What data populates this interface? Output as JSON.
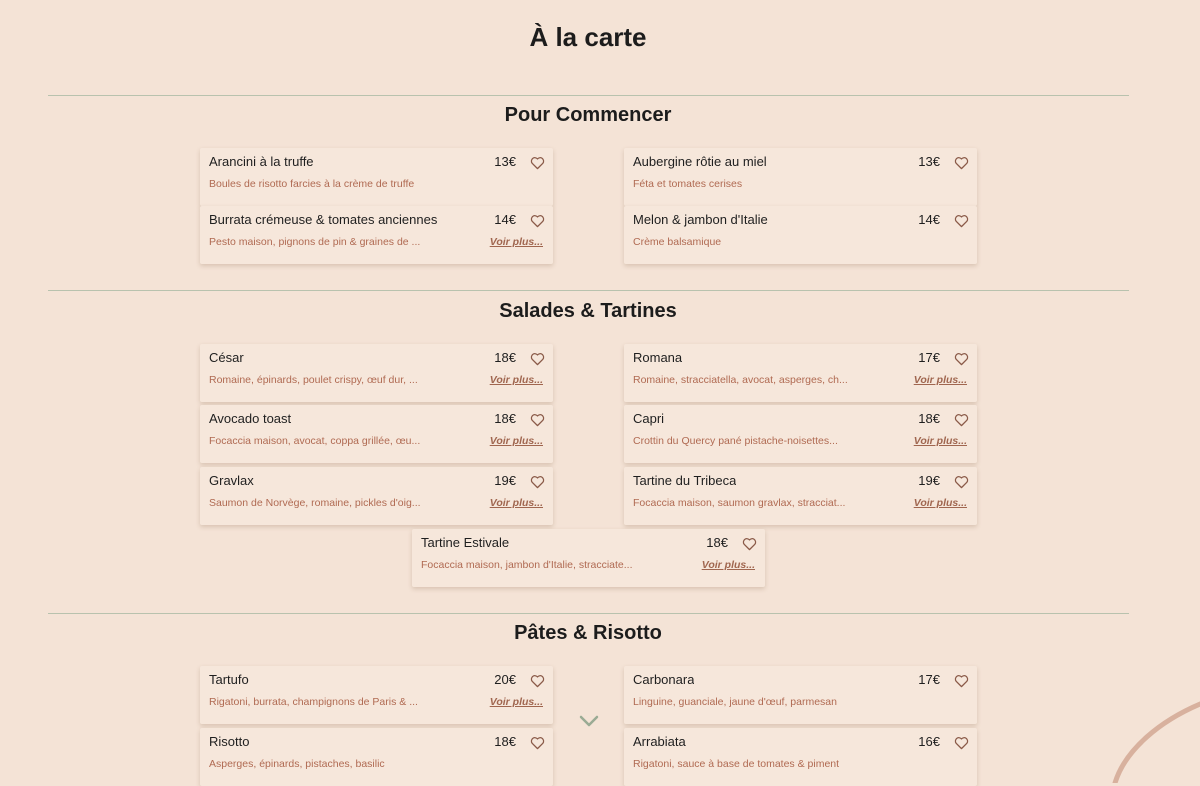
{
  "page": {
    "title": "À la carte",
    "more_label": "Voir plus...",
    "colors": {
      "background": "#f4e3d6",
      "card": "#f6e7db",
      "description": "#b06a52",
      "divider": "#b8c2ae",
      "chevron": "#9aab94"
    }
  },
  "sections": [
    {
      "title": "Pour Commencer",
      "items": [
        {
          "name": "Arancini à la truffe",
          "price": "13€",
          "desc": "Boules de risotto farcies à la crème de truffe",
          "more": ""
        },
        {
          "name": "Aubergine rôtie au miel",
          "price": "13€",
          "desc": "Féta et tomates cerises",
          "more": ""
        },
        {
          "name": "Burrata crémeuse & tomates anciennes",
          "price": "14€",
          "desc": "Pesto maison, pignons de pin & graines de ...",
          "more": "Voir plus..."
        },
        {
          "name": "Melon & jambon d'Italie",
          "price": "14€",
          "desc": "Crème balsamique",
          "more": ""
        }
      ]
    },
    {
      "title": "Salades & Tartines",
      "items": [
        {
          "name": "César",
          "price": "18€",
          "desc": "Romaine, épinards, poulet crispy, œuf dur, ...",
          "more": "Voir plus..."
        },
        {
          "name": "Romana",
          "price": "17€",
          "desc": "Romaine, stracciatella, avocat, asperges, ch...",
          "more": "Voir plus..."
        },
        {
          "name": "Avocado toast",
          "price": "18€",
          "desc": "Focaccia maison, avocat, coppa grillée, œu...",
          "more": "Voir plus..."
        },
        {
          "name": "Capri",
          "price": "18€",
          "desc": "Crottin du Quercy pané pistache-noisettes...",
          "more": "Voir plus..."
        },
        {
          "name": "Gravlax",
          "price": "19€",
          "desc": "Saumon de Norvège, romaine, pickles d'oig...",
          "more": "Voir plus..."
        },
        {
          "name": "Tartine du Tribeca",
          "price": "19€",
          "desc": "Focaccia maison, saumon gravlax, stracciat...",
          "more": "Voir plus..."
        },
        {
          "name": "Tartine Estivale",
          "price": "18€",
          "desc": "Focaccia maison, jambon d'Italie, stracciate...",
          "more": "Voir plus..."
        }
      ]
    },
    {
      "title": "Pâtes & Risotto",
      "items": [
        {
          "name": "Tartufo",
          "price": "20€",
          "desc": "Rigatoni, burrata, champignons de Paris & ...",
          "more": "Voir plus..."
        },
        {
          "name": "Carbonara",
          "price": "17€",
          "desc": "Linguine, guanciale, jaune d'œuf, parmesan",
          "more": ""
        },
        {
          "name": "Risotto",
          "price": "18€",
          "desc": "Asperges, épinards, pistaches, basilic",
          "more": ""
        },
        {
          "name": "Arrabiata",
          "price": "16€",
          "desc": "Rigatoni, sauce à base de tomates & piment",
          "more": ""
        }
      ]
    }
  ]
}
